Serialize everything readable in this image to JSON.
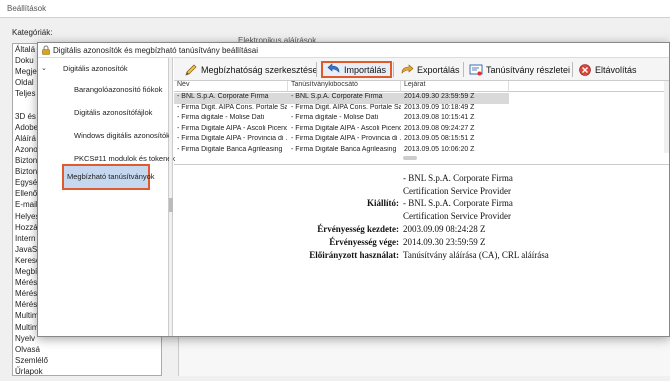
{
  "background": {
    "title": "Beállítások",
    "categories_label": "Kategóriák:",
    "right_fragment": "Elektronikus aláírások",
    "list_items": [
      "Általá",
      "Doku",
      "Megje",
      "Oldal",
      "Teljes",
      "",
      "3D és",
      "Adobe",
      "Aláírá",
      "Azono",
      "Bizton",
      "Bizton",
      "Egység",
      "Ellenő",
      "E-mail",
      "Helyes",
      "Hozzá",
      "Intern",
      "JavaSc",
      "Keresé",
      "Megbí",
      "Mérés",
      "Mérés",
      "Mérés",
      "Multim",
      "Multim",
      "Nyelv",
      "Olvasá",
      "Szemlélő",
      "Űrlapok"
    ]
  },
  "dialog": {
    "title": "Digitális azonosítók és megbízható tanúsítvány beállításai",
    "nav": {
      "parent": "Digitális azonosítók",
      "children": [
        "Barangolóazonosító fiókok",
        "Digitális azonosítófájlok",
        "Windows digitális azonosítók",
        "PKCS#11 modulok és tokenek"
      ],
      "selected": "Megbízható tanúsítványok"
    },
    "toolbar": {
      "edit_trust": "Megbízhatóság szerkesztése",
      "import": "Importálás",
      "export": "Exportálás",
      "details": "Tanúsítvány részletei",
      "remove": "Eltávolítás"
    },
    "table": {
      "columns": [
        "Név",
        "Tanúsítványkibocsátó",
        "Lejárat"
      ],
      "rows": [
        [
          "- BNL S.p.A. Corporate Firma",
          "- BNL S.p.A. Corporate Firma",
          "2014.09.30 23:59:59 Z"
        ],
        [
          "- Firma Digit. AIPA Cons. Portale Sa...",
          "- Firma Digit. AIPA Cons. Portale Sa...",
          "2013.09.09 10:18:49 Z"
        ],
        [
          "- Firma digitale - Molise Dati",
          "- Firma digitale - Molise Dati",
          "2013.09.08 10:15:41 Z"
        ],
        [
          "- Firma Digitale AIPA - Ascoli Piceno",
          "- Firma Digitale AIPA - Ascoli Piceno",
          "2013.09.08 09:24:27 Z"
        ],
        [
          "- Firma Digitale AIPA - Provincia di ...",
          "- Firma Digitale AIPA - Provincia di ...",
          "2013.09.05 08:15:51 Z"
        ],
        [
          "- Firma Digitale Banca Agrileasing",
          "- Firma Digitale Banca Agrileasing",
          "2013.09.05 10:06:20 Z"
        ]
      ],
      "selected_row": 0
    },
    "details": {
      "subject_line1": "- BNL S.p.A. Corporate Firma",
      "subject_line2": "Certification Service Provider",
      "issuer_label": "Kiállító:",
      "issuer_line1": "- BNL S.p.A. Corporate Firma",
      "issuer_line2": "Certification Service Provider",
      "valid_from_label": "Érvényesség kezdete:",
      "valid_from": "2003.09.09 08:24:28 Z",
      "valid_to_label": "Érvényesség vége:",
      "valid_to": "2014.09.30 23:59:59 Z",
      "intended_use_label": "Előirányzott használat:",
      "intended_use": "Tanúsítvány aláírása (CA), CRL aláírása"
    }
  },
  "colors": {
    "highlight_border": "#e05a2b",
    "selected_nav_bg": "#c5d8ef",
    "selected_row_bg": "#d9d9d9"
  },
  "icons": {
    "edit_trust": "pencil-icon",
    "import": "import-arrow-icon",
    "export": "export-arrow-icon",
    "details": "certificate-icon",
    "remove": "remove-icon",
    "title": "lock-icon"
  }
}
